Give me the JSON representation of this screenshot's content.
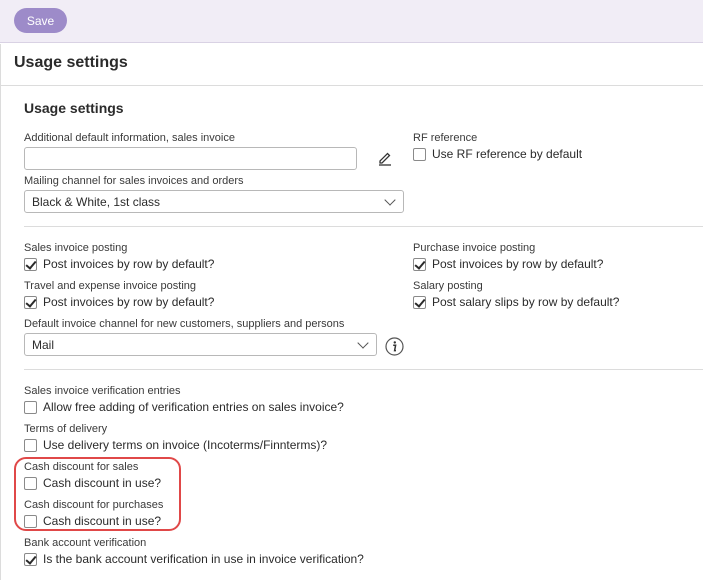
{
  "toolbar": {
    "save_label": "Save"
  },
  "page": {
    "title": "Usage settings"
  },
  "section": {
    "title": "Usage settings"
  },
  "fields": {
    "additional_info_label": "Additional default information, sales invoice",
    "additional_info_value": "",
    "mailing_channel_label": "Mailing channel for sales invoices and orders",
    "mailing_channel_value": "Black & White, 1st class",
    "rf_reference_label": "RF reference",
    "rf_reference_checkbox": "Use RF reference by default",
    "sales_posting_label": "Sales invoice posting",
    "sales_posting_checkbox": "Post invoices by row by default?",
    "purchase_posting_label": "Purchase invoice posting",
    "purchase_posting_checkbox": "Post invoices by row by default?",
    "travel_posting_label": "Travel and expense invoice posting",
    "travel_posting_checkbox": "Post invoices by row by default?",
    "salary_posting_label": "Salary posting",
    "salary_posting_checkbox": "Post salary slips by row by default?",
    "default_channel_label": "Default invoice channel for new customers, suppliers and persons",
    "default_channel_value": "Mail",
    "verification_entries_label": "Sales invoice verification entries",
    "verification_entries_checkbox": "Allow free adding of verification entries on sales invoice?",
    "delivery_terms_label": "Terms of delivery",
    "delivery_terms_checkbox": "Use delivery terms on invoice (Incoterms/Finnterms)?",
    "cash_discount_sales_label": "Cash discount for sales",
    "cash_discount_sales_checkbox": "Cash discount in use?",
    "cash_discount_purchases_label": "Cash discount for purchases",
    "cash_discount_purchases_checkbox": "Cash discount in use?",
    "bank_verification_label": "Bank account verification",
    "bank_verification_checkbox": "Is the bank account verification in use in invoice verification?"
  },
  "checked": {
    "rf_reference": false,
    "sales_posting": true,
    "purchase_posting": true,
    "travel_posting": true,
    "salary_posting": true,
    "verification_entries": false,
    "delivery_terms": false,
    "cash_discount_sales": false,
    "cash_discount_purchases": false,
    "bank_verification": true
  },
  "icons": {
    "edit": "pencil-icon",
    "info": "info-icon",
    "dropdown": "chevron-down-icon"
  },
  "colors": {
    "accent": "#9d8bc9",
    "header_bg": "#f1edf6",
    "highlight": "#e04848"
  }
}
